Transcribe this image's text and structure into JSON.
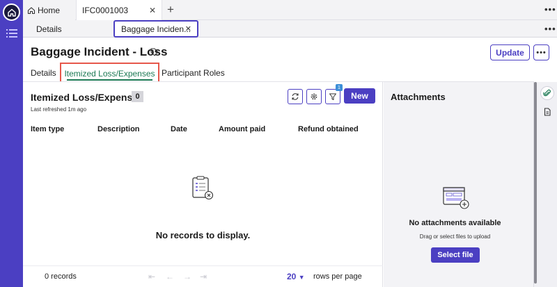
{
  "colors": {
    "brand": "#4b3fc2",
    "active_tab_green": "#1e7a55",
    "highlight_red": "#e6574a",
    "filter_badge": "#3d8fd8"
  },
  "window_tabs": [
    {
      "label": "Home",
      "icon": "home-icon"
    },
    {
      "label": "IFC0001003",
      "icon": "close-icon"
    }
  ],
  "sub_tabs": [
    {
      "label": "Details"
    },
    {
      "label": "Baggage Inciden...",
      "icon": "close-icon"
    }
  ],
  "header": {
    "title": "Baggage Incident - Loss",
    "update_label": "Update",
    "more_label": "•••"
  },
  "record_tabs": [
    "Details",
    "Itemized Loss/Expenses",
    "Participant Roles"
  ],
  "list": {
    "title": "Itemized Loss/Expenses",
    "count": "0",
    "last_refreshed": "Last refreshed 1m ago",
    "filter_count": "1",
    "new_label": "New",
    "columns": [
      "Item type",
      "Description",
      "Date",
      "Amount paid",
      "Refund obtained"
    ],
    "empty_message": "No records to display.",
    "records_count": "0 records",
    "page_size": "20",
    "rows_per_page_label": "rows per page"
  },
  "attachments": {
    "title": "Attachments",
    "empty_title": "No attachments available",
    "hint": "Drag or select files to upload",
    "select_label": "Select file"
  }
}
